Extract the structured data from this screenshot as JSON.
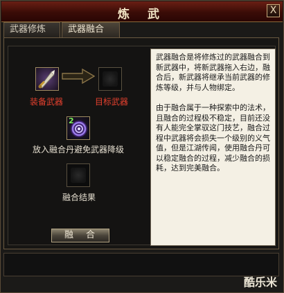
{
  "window": {
    "title": "炼 武",
    "close_label": "X"
  },
  "tabs": [
    {
      "label": "武器修炼",
      "active": false
    },
    {
      "label": "武器融合",
      "active": true
    }
  ],
  "slots": {
    "equipped_weapon": {
      "label": "装备武器",
      "filled": true,
      "icon": "sword-icon"
    },
    "target_weapon": {
      "label": "目标武器",
      "filled": false
    },
    "fusion_pill": {
      "label": "放入融合丹避免武器降级",
      "count": "2",
      "icon": "purple-swirl-pill-icon"
    },
    "result": {
      "label": "融合结果",
      "filled": false
    }
  },
  "description": {
    "paragraph1": "武器融合是将修炼过的武器融合到新武器中，将新武器拖入右边，融合后，新武器将继承当前武器的修炼等级，并与人物绑定。",
    "paragraph2": "由于融合属于一种探索中的法术，且融合的过程极不稳定，目前还没有人能完全掌驭这门技艺，融合过程中武器将会损失一个级别的义气值，但是江湖传闻，使用融合丹可以稳定融合的过程，减少融合的损耗，达到完美融合。"
  },
  "actions": {
    "fuse_button": "融合"
  },
  "watermark": "酷乐米",
  "colors": {
    "label_red": "#e4402e",
    "title_bar": "#6a1f14",
    "text_panel_bg": "#f4f0e4"
  }
}
